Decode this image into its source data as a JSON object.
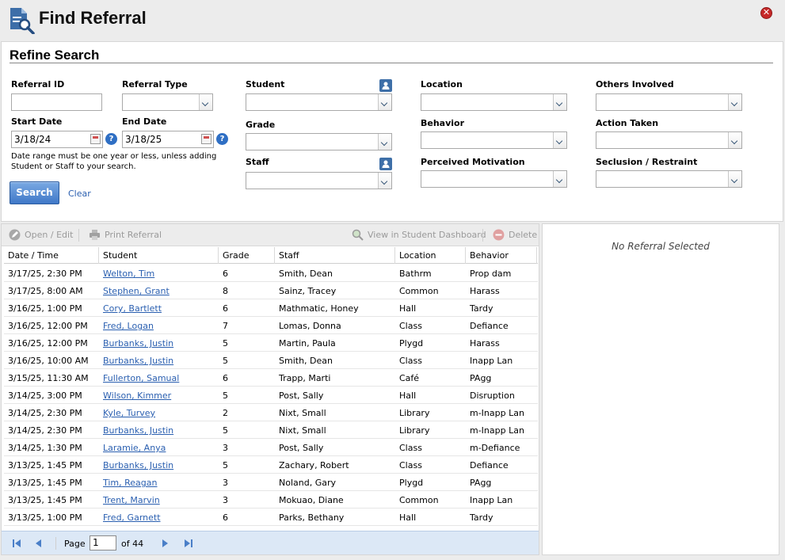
{
  "window": {
    "title": "Find Referral",
    "close_symbol": "✕"
  },
  "search": {
    "section_title": "Refine Search",
    "fields": {
      "referral_id": {
        "label": "Referral ID",
        "value": ""
      },
      "referral_type": {
        "label": "Referral Type",
        "value": ""
      },
      "start_date": {
        "label": "Start Date",
        "value": "3/18/24"
      },
      "end_date": {
        "label": "End Date",
        "value": "3/18/25"
      },
      "student": {
        "label": "Student",
        "value": ""
      },
      "grade": {
        "label": "Grade",
        "value": ""
      },
      "staff": {
        "label": "Staff",
        "value": ""
      },
      "location": {
        "label": "Location",
        "value": ""
      },
      "behavior": {
        "label": "Behavior",
        "value": ""
      },
      "perceived_motivation": {
        "label": "Perceived Motivation",
        "value": ""
      },
      "others_involved": {
        "label": "Others Involved",
        "value": ""
      },
      "action_taken": {
        "label": "Action Taken",
        "value": ""
      },
      "seclusion_restraint": {
        "label": "Seclusion / Restraint",
        "value": ""
      }
    },
    "help_symbol": "?",
    "date_note": "Date range must be one year or less, unless adding Student or Staff to your search.",
    "search_button": "Search",
    "clear_link": "Clear"
  },
  "toolbar": {
    "open_edit": "Open / Edit",
    "print_referral": "Print Referral",
    "view_dashboard": "View in Student Dashboard",
    "delete": "Delete"
  },
  "grid": {
    "columns": [
      "Date / Time",
      "Student",
      "Grade",
      "Staff",
      "Location",
      "Behavior"
    ],
    "rows": [
      [
        "3/17/25, 2:30 PM",
        "Welton, Tim",
        "6",
        "Smith, Dean",
        "Bathrm",
        "Prop dam"
      ],
      [
        "3/17/25, 8:00 AM",
        "Stephen, Grant",
        "8",
        "Sainz, Tracey",
        "Common",
        "Harass"
      ],
      [
        "3/16/25, 1:00 PM",
        "Cory, Bartlett",
        "6",
        "Mathmatic, Honey",
        "Hall",
        "Tardy"
      ],
      [
        "3/16/25, 12:00 PM",
        "Fred, Logan",
        "7",
        "Lomas, Donna",
        "Class",
        "Defiance"
      ],
      [
        "3/16/25, 12:00 PM",
        "Burbanks, Justin",
        "5",
        "Martin, Paula",
        "Plygd",
        "Harass"
      ],
      [
        "3/16/25, 10:00 AM",
        "Burbanks, Justin",
        "5",
        "Smith, Dean",
        "Class",
        "Inapp Lan"
      ],
      [
        "3/15/25, 11:30 AM",
        "Fullerton, Samual",
        "6",
        "Trapp, Marti",
        "Café",
        "PAgg"
      ],
      [
        "3/14/25, 3:00 PM",
        "Wilson, Kimmer",
        "5",
        "Post, Sally",
        "Hall",
        "Disruption"
      ],
      [
        "3/14/25, 2:30 PM",
        "Kyle, Turvey",
        "2",
        "Nixt, Small",
        "Library",
        "m-Inapp Lan"
      ],
      [
        "3/14/25, 2:30 PM",
        "Burbanks, Justin",
        "5",
        "Nixt, Small",
        "Library",
        "m-Inapp Lan"
      ],
      [
        "3/14/25, 1:30 PM",
        "Laramie, Anya",
        "3",
        "Post, Sally",
        "Class",
        "m-Defiance"
      ],
      [
        "3/13/25, 1:45 PM",
        "Burbanks, Justin",
        "5",
        "Zachary, Robert",
        "Class",
        "Defiance"
      ],
      [
        "3/13/25, 1:45 PM",
        "Tim, Reagan",
        "3",
        "Noland, Gary",
        "Plygd",
        "PAgg"
      ],
      [
        "3/13/25, 1:45 PM",
        "Trent, Marvin",
        "3",
        "Mokuao, Diane",
        "Common",
        "Inapp Lan"
      ],
      [
        "3/13/25, 1:00 PM",
        "Fred, Garnett",
        "6",
        "Parks, Bethany",
        "Hall",
        "Tardy"
      ]
    ]
  },
  "pager": {
    "page_label": "Page",
    "current_page": "1",
    "of_label": "of 44"
  },
  "detail": {
    "empty_text": "No Referral Selected"
  },
  "colors": {
    "accent": "#3f78c8",
    "link": "#2a5fb0",
    "close": "#c62828",
    "pager_bg": "#dce8f6"
  }
}
